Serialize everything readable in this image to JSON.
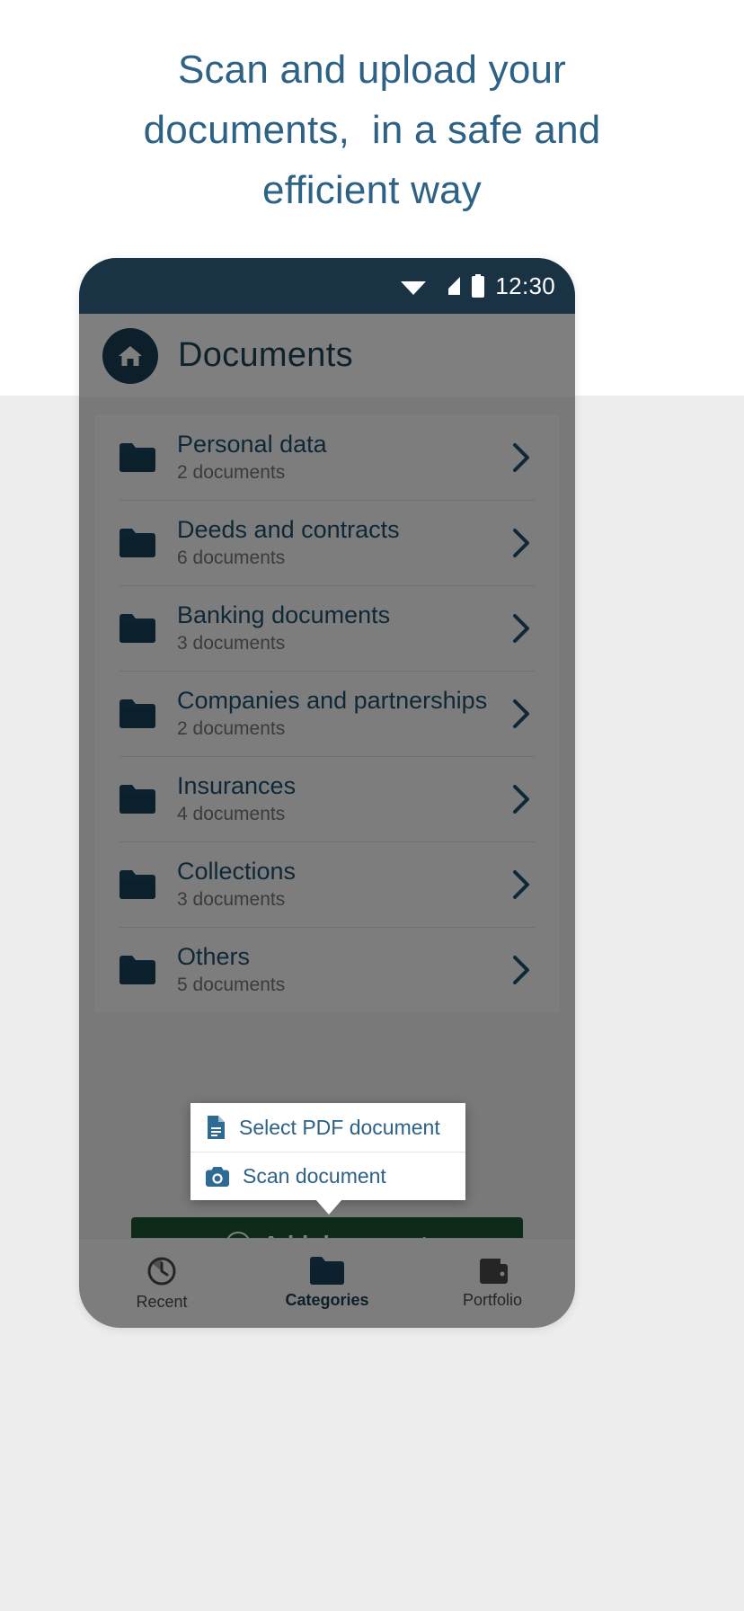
{
  "headline": {
    "lines": [
      "Scan and upload your",
      "documents,  in a safe and",
      "efficient way"
    ],
    "color": "#2d6185"
  },
  "phone": {
    "status_bar": {
      "time": "12:30",
      "icons": [
        "wifi-icon",
        "cellular-signal-icon",
        "battery-icon"
      ],
      "background": "#1a3344"
    },
    "app_header": {
      "home_icon": "home-icon",
      "title": "Documents"
    },
    "categories": [
      {
        "title": "Personal data",
        "subtitle": "2 documents",
        "icon": "folder-icon",
        "chevron": "chevron-right-icon"
      },
      {
        "title": "Deeds and contracts",
        "subtitle": "6 documents",
        "icon": "folder-icon",
        "chevron": "chevron-right-icon"
      },
      {
        "title": "Banking documents",
        "subtitle": "3 documents",
        "icon": "folder-icon",
        "chevron": "chevron-right-icon"
      },
      {
        "title": "Companies and partnerships",
        "subtitle": "2 documents",
        "icon": "folder-icon",
        "chevron": "chevron-right-icon"
      },
      {
        "title": "Insurances",
        "subtitle": "4 documents",
        "icon": "folder-icon",
        "chevron": "chevron-right-icon"
      },
      {
        "title": "Collections",
        "subtitle": "3 documents",
        "icon": "folder-icon",
        "chevron": "chevron-right-icon"
      },
      {
        "title": "Others",
        "subtitle": "5 documents",
        "icon": "folder-icon",
        "chevron": "chevron-right-icon"
      }
    ],
    "popup_menu": {
      "items": [
        {
          "label": "Select PDF document",
          "icon": "pdf-document-icon"
        },
        {
          "label": "Scan document",
          "icon": "camera-icon"
        }
      ]
    },
    "add_button": {
      "label": "Add document",
      "icon": "plus-circle-icon",
      "color": "#1d5632"
    },
    "bottom_nav": [
      {
        "label": "Recent",
        "icon": "clock-icon",
        "active": false
      },
      {
        "label": "Categories",
        "icon": "folder-icon",
        "active": true
      },
      {
        "label": "Portfolio",
        "icon": "wallet-icon",
        "active": false
      }
    ]
  },
  "colors": {
    "navy": "#1a3e55",
    "link_blue": "#2d6185",
    "green": "#1d5632",
    "page_gray": "#eeeded"
  }
}
